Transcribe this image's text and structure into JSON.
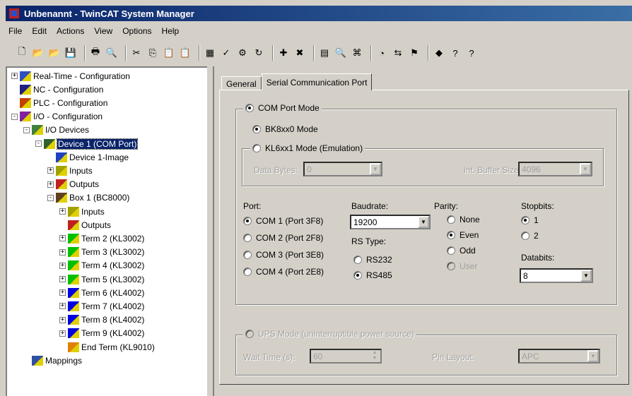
{
  "window": {
    "title": "Unbenannt - TwinCAT System Manager"
  },
  "menu": [
    "File",
    "Edit",
    "Actions",
    "View",
    "Options",
    "Help"
  ],
  "toolbar": {
    "icons": [
      "new-icon",
      "open-icon",
      "open-project-icon",
      "save-icon",
      "sep",
      "print-icon",
      "print-preview-icon",
      "sep",
      "cut-icon",
      "copy-icon",
      "paste-icon",
      "paste-link-icon",
      "sep",
      "generate-mappings-icon",
      "check-configuration-icon",
      "activate-configuration-icon",
      "restart-icon",
      "sep",
      "add-icon",
      "delete-icon",
      "sep",
      "scan-icon",
      "find-icon",
      "network-icon",
      "sep",
      "monitor-icon",
      "toggle-icon",
      "freerun-icon",
      "sep",
      "help-book-icon",
      "help-icon",
      "whats-this-icon"
    ]
  },
  "tree": [
    {
      "label": "Real-Time - Configuration",
      "level": 0,
      "expander": "+",
      "icon": "realtime-icon"
    },
    {
      "label": "NC - Configuration",
      "level": 0,
      "expander": "",
      "icon": "nc-icon"
    },
    {
      "label": "PLC - Configuration",
      "level": 0,
      "expander": "",
      "icon": "plc-icon"
    },
    {
      "label": "I/O - Configuration",
      "level": 0,
      "expander": "-",
      "icon": "io-icon"
    },
    {
      "label": "I/O Devices",
      "level": 1,
      "expander": "-",
      "icon": "devices-icon"
    },
    {
      "label": "Device 1 (COM Port)",
      "level": 2,
      "expander": "-",
      "icon": "device-icon",
      "selected": true
    },
    {
      "label": "Device 1-Image",
      "level": 3,
      "expander": "",
      "icon": "image-icon"
    },
    {
      "label": "Inputs",
      "level": 3,
      "expander": "+",
      "icon": "inputs-icon"
    },
    {
      "label": "Outputs",
      "level": 3,
      "expander": "+",
      "icon": "outputs-icon"
    },
    {
      "label": "Box 1 (BC8000)",
      "level": 3,
      "expander": "-",
      "icon": "box-icon"
    },
    {
      "label": "Inputs",
      "level": 4,
      "expander": "+",
      "icon": "inputs-icon"
    },
    {
      "label": "Outputs",
      "level": 4,
      "expander": "",
      "icon": "outputs-icon"
    },
    {
      "label": "Term 2 (KL3002)",
      "level": 4,
      "expander": "+",
      "icon": "term-green-icon"
    },
    {
      "label": "Term 3 (KL3002)",
      "level": 4,
      "expander": "+",
      "icon": "term-green-icon"
    },
    {
      "label": "Term 4 (KL3002)",
      "level": 4,
      "expander": "+",
      "icon": "term-green-icon"
    },
    {
      "label": "Term 5 (KL3002)",
      "level": 4,
      "expander": "+",
      "icon": "term-green-icon"
    },
    {
      "label": "Term 6 (KL4002)",
      "level": 4,
      "expander": "+",
      "icon": "term-blue-icon"
    },
    {
      "label": "Term 7 (KL4002)",
      "level": 4,
      "expander": "+",
      "icon": "term-blue-icon"
    },
    {
      "label": "Term 8 (KL4002)",
      "level": 4,
      "expander": "+",
      "icon": "term-blue-icon"
    },
    {
      "label": "Term 9 (KL4002)",
      "level": 4,
      "expander": "+",
      "icon": "term-blue-icon"
    },
    {
      "label": "End Term (KL9010)",
      "level": 4,
      "expander": "",
      "icon": "term-orange-icon"
    },
    {
      "label": "Mappings",
      "level": 1,
      "expander": "",
      "icon": "mappings-icon"
    }
  ],
  "tabs": [
    {
      "label": "General",
      "active": false
    },
    {
      "label": "Serial Communication Port",
      "active": true
    }
  ],
  "com_group": {
    "label": "COM Port Mode"
  },
  "bk_mode": {
    "label": "BK8xx0 Mode"
  },
  "kl_group": {
    "label": "KL6xx1 Mode (Emulation)"
  },
  "data_bytes": {
    "label": "Data Bytes:",
    "value": "0"
  },
  "int_buffer": {
    "label": "int. Buffer Size:",
    "value": "4096"
  },
  "port": {
    "label": "Port:",
    "options": [
      "COM 1 (Port 3F8)",
      "COM 2 (Port 2F8)",
      "COM 3 (Port 3E8)",
      "COM 4 (Port 2E8)"
    ]
  },
  "baudrate": {
    "label": "Baudrate:",
    "value": "19200"
  },
  "rs_type": {
    "label": "RS Type:",
    "options": [
      "RS232",
      "RS485"
    ]
  },
  "parity": {
    "label": "Parity:",
    "options": [
      "None",
      "Even",
      "Odd",
      "User"
    ]
  },
  "stopbits": {
    "label": "Stopbits:",
    "options": [
      "1",
      "2"
    ]
  },
  "databits": {
    "label": "Databits:",
    "value": "8"
  },
  "ups": {
    "label": "UPS Mode (uninterruptible power source)"
  },
  "wait_time": {
    "label": "Wait Time (s):",
    "value": "60"
  },
  "pin_layout": {
    "label": "Pin Layout:",
    "value": "APC"
  }
}
